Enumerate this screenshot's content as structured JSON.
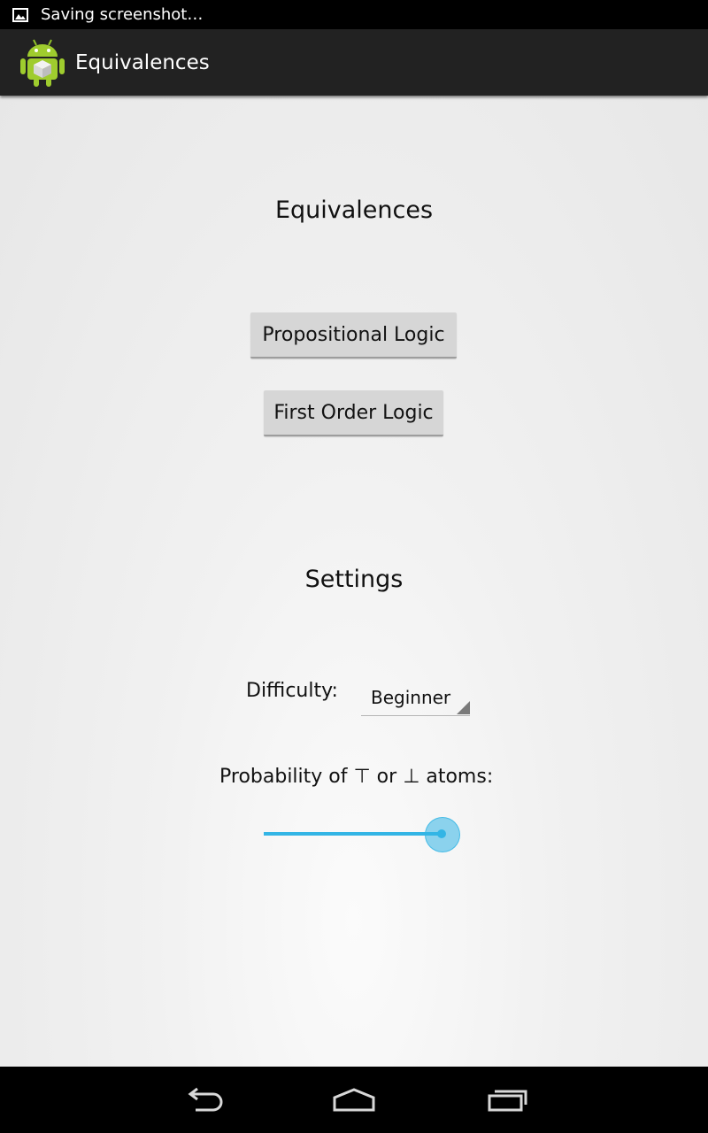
{
  "status_bar": {
    "notification_text": "Saving screenshot…",
    "notification_icon": "image-icon"
  },
  "action_bar": {
    "app_icon": "android-app-icon",
    "title": "Equivalences"
  },
  "main": {
    "heading": "Equivalences",
    "buttons": {
      "propositional": "Propositional Logic",
      "first_order": "First Order Logic"
    }
  },
  "settings": {
    "heading": "Settings",
    "difficulty_label": "Difficulty:",
    "difficulty_value": "Beginner",
    "probability_label_prefix": "Probability of",
    "top_symbol": "⊤",
    "probability_label_or": "or",
    "bottom_symbol": "⊥",
    "probability_label_suffix": "atoms:",
    "probability_fraction": 1.0
  },
  "nav_bar": {
    "back_icon": "back-icon",
    "home_icon": "home-icon",
    "recents_icon": "recent-apps-icon"
  },
  "colors": {
    "accent": "#33b5e5",
    "action_bar": "#222222",
    "button": "#d6d6d6"
  }
}
